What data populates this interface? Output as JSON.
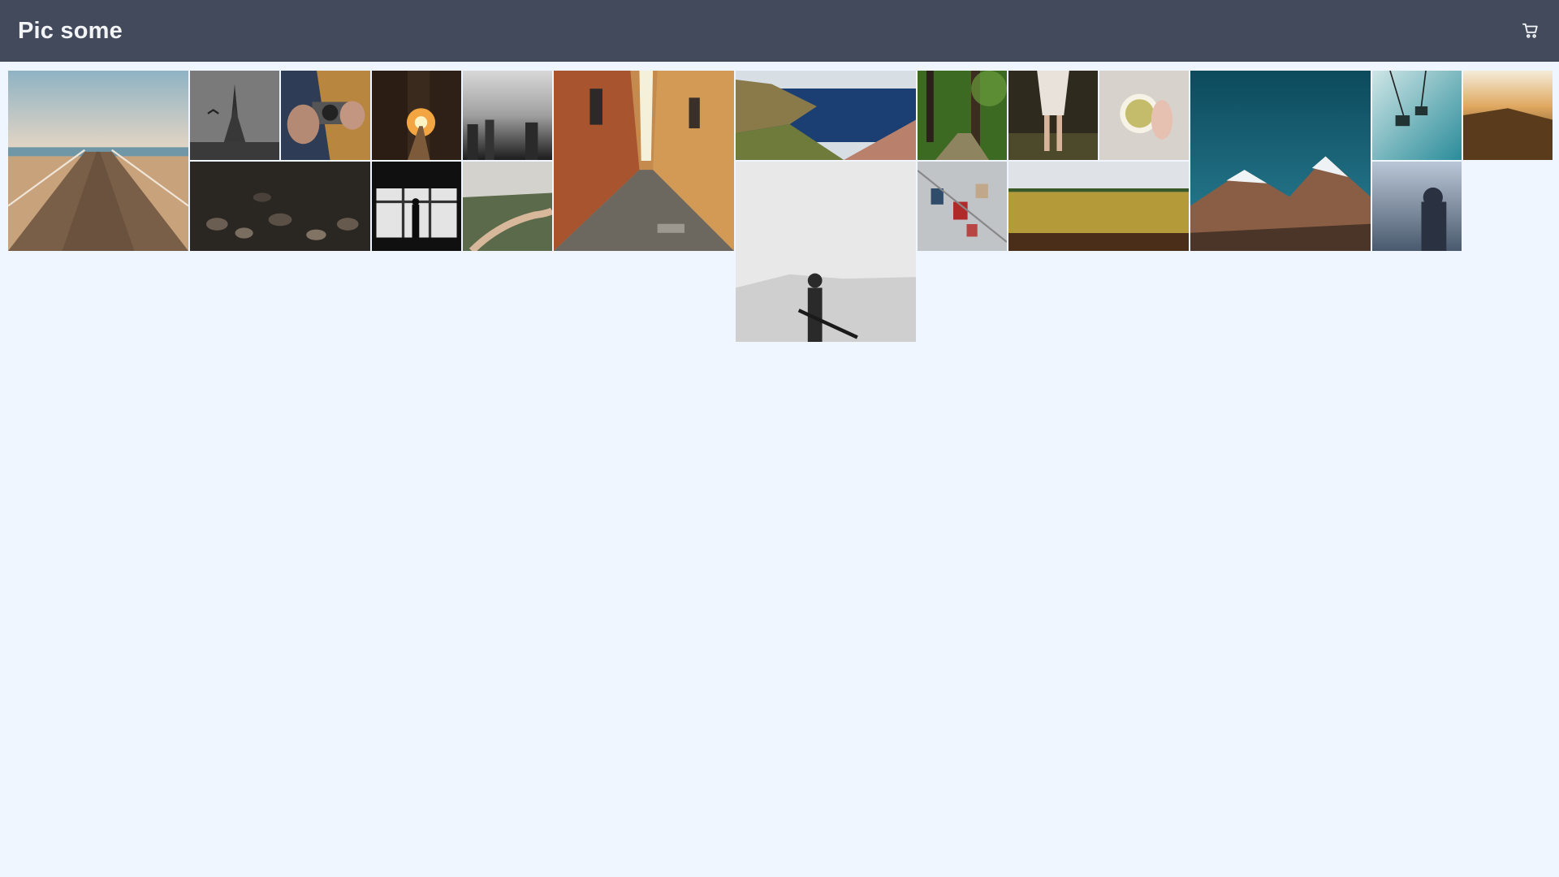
{
  "header": {
    "title": "Pic some",
    "cart_icon": "cart-icon"
  },
  "colors": {
    "header_bg": "#424a5c",
    "page_bg": "#eff6ff",
    "title_text": "#f3f4f6"
  },
  "gallery": {
    "photos": [
      {
        "subject": "pier-boardwalk",
        "size": "large"
      },
      {
        "subject": "eiffel-tower-bw",
        "size": "small"
      },
      {
        "subject": "hands-holding-camera",
        "size": "small"
      },
      {
        "subject": "city-street-sunset",
        "size": "small"
      },
      {
        "subject": "foggy-city-bw",
        "size": "small"
      },
      {
        "subject": "narrow-alley-cobblestone",
        "size": "large"
      },
      {
        "subject": "coastal-cliffs-sea",
        "size": "wide"
      },
      {
        "subject": "forest-path",
        "size": "small"
      },
      {
        "subject": "girl-in-forest",
        "size": "small"
      },
      {
        "subject": "hand-holding-cup",
        "size": "small"
      },
      {
        "subject": "snowy-mountains",
        "size": "large"
      },
      {
        "subject": "cable-car-gondola",
        "size": "small"
      },
      {
        "subject": "sunset-field",
        "size": "small"
      },
      {
        "subject": "pebble-stones",
        "size": "wide"
      },
      {
        "subject": "silhouette-window",
        "size": "small"
      },
      {
        "subject": "dirt-road-woods",
        "size": "small"
      },
      {
        "subject": "desert-guitar-player",
        "size": "large"
      },
      {
        "subject": "love-padlocks",
        "size": "small"
      },
      {
        "subject": "wheat-field",
        "size": "wide"
      },
      {
        "subject": "hooded-figure-coast",
        "size": "small"
      }
    ]
  }
}
